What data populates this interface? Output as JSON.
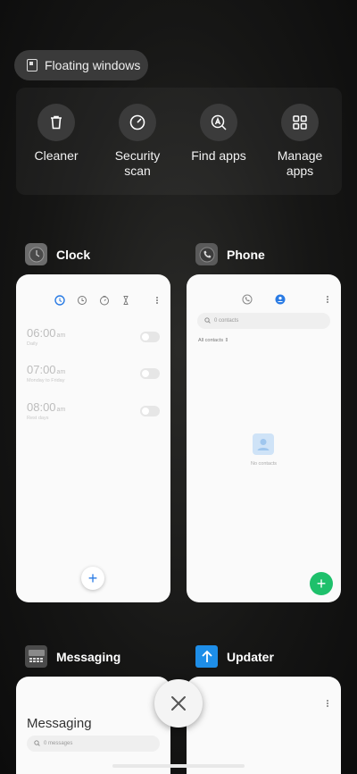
{
  "floating_windows": {
    "label": "Floating windows",
    "icon": "floating-window-icon"
  },
  "quick_actions": [
    {
      "id": "cleaner",
      "line1": "Cleaner",
      "line2": "",
      "icon": "trash-icon"
    },
    {
      "id": "security",
      "line1": "Security",
      "line2": "scan",
      "icon": "security-scan-icon"
    },
    {
      "id": "find-apps",
      "line1": "Find apps",
      "line2": "",
      "icon": "find-apps-icon"
    },
    {
      "id": "manage-apps",
      "line1": "Manage",
      "line2": "apps",
      "icon": "grid-icon"
    }
  ],
  "recents": {
    "clock": {
      "name": "Clock",
      "alarms": [
        {
          "time": "06:00",
          "ampm": "am",
          "desc": "Daily"
        },
        {
          "time": "07:00",
          "ampm": "am",
          "desc": "Monday to Friday"
        },
        {
          "time": "08:00",
          "ampm": "am",
          "desc": "Rest days"
        }
      ],
      "fab": "+"
    },
    "phone": {
      "name": "Phone",
      "search_placeholder": "0 contacts",
      "filter": "All contacts",
      "empty_text": "No contacts",
      "fab": "+"
    },
    "messaging": {
      "name": "Messaging",
      "title": "Messaging",
      "search_placeholder": "0 messages"
    },
    "updater": {
      "name": "Updater"
    }
  },
  "close_all": {
    "icon": "close-icon"
  },
  "colors": {
    "accent_blue": "#2a7be4",
    "fab_green": "#1ec06b",
    "updater_blue": "#1e8ee8"
  }
}
